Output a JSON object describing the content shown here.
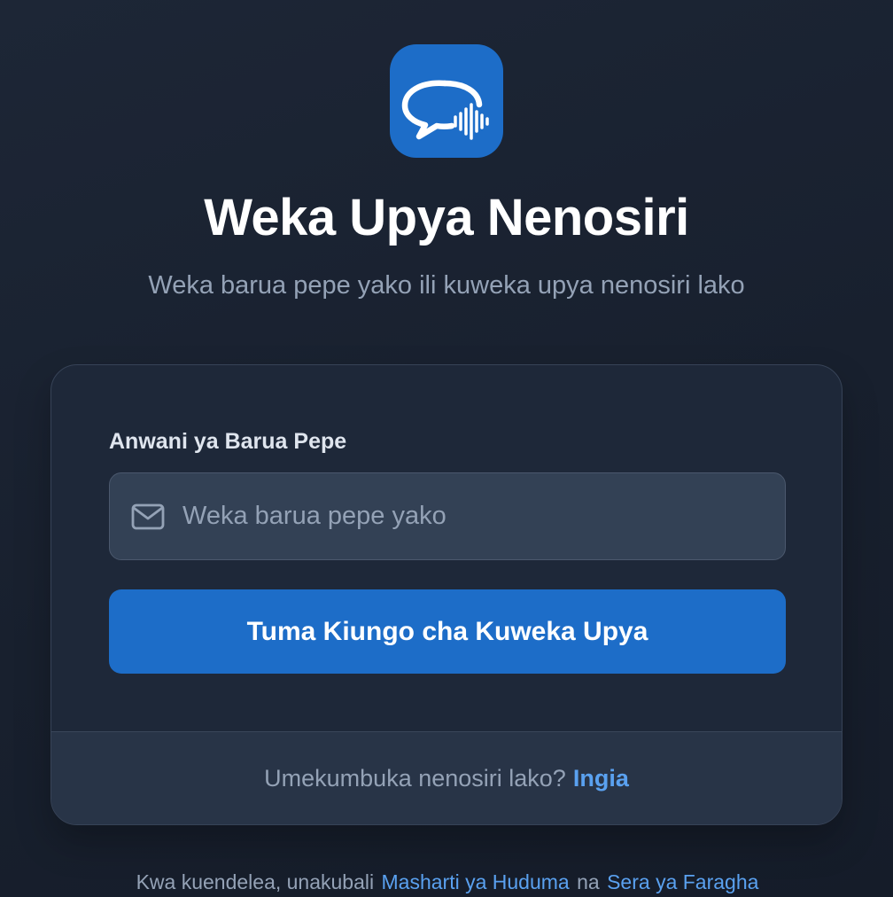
{
  "app": {
    "logo_icon": "chat-bubble-voice-icon",
    "brand_color": "#1d6dc8"
  },
  "header": {
    "title": "Weka Upya Nenosiri",
    "subtitle": "Weka barua pepe yako ili kuweka upya nenosiri lako"
  },
  "form": {
    "email_label": "Anwani ya Barua Pepe",
    "email_icon": "mail-icon",
    "email_placeholder": "Weka barua pepe yako",
    "email_value": "",
    "submit_label": "Tuma Kiungo cha Kuweka Upya"
  },
  "footer": {
    "prompt": "Umekumbuka nenosiri lako?",
    "signin_link": "Ingia"
  },
  "terms": {
    "prefix": "Kwa kuendelea, unakubali",
    "terms_link": "Masharti ya Huduma",
    "conjunction": "na",
    "privacy_link": "Sera ya Faragha"
  },
  "colors": {
    "background": "#1b2331",
    "card": "#1e2839",
    "input": "#334155",
    "link": "#5aa1f0",
    "muted_text": "#94a2b6"
  }
}
